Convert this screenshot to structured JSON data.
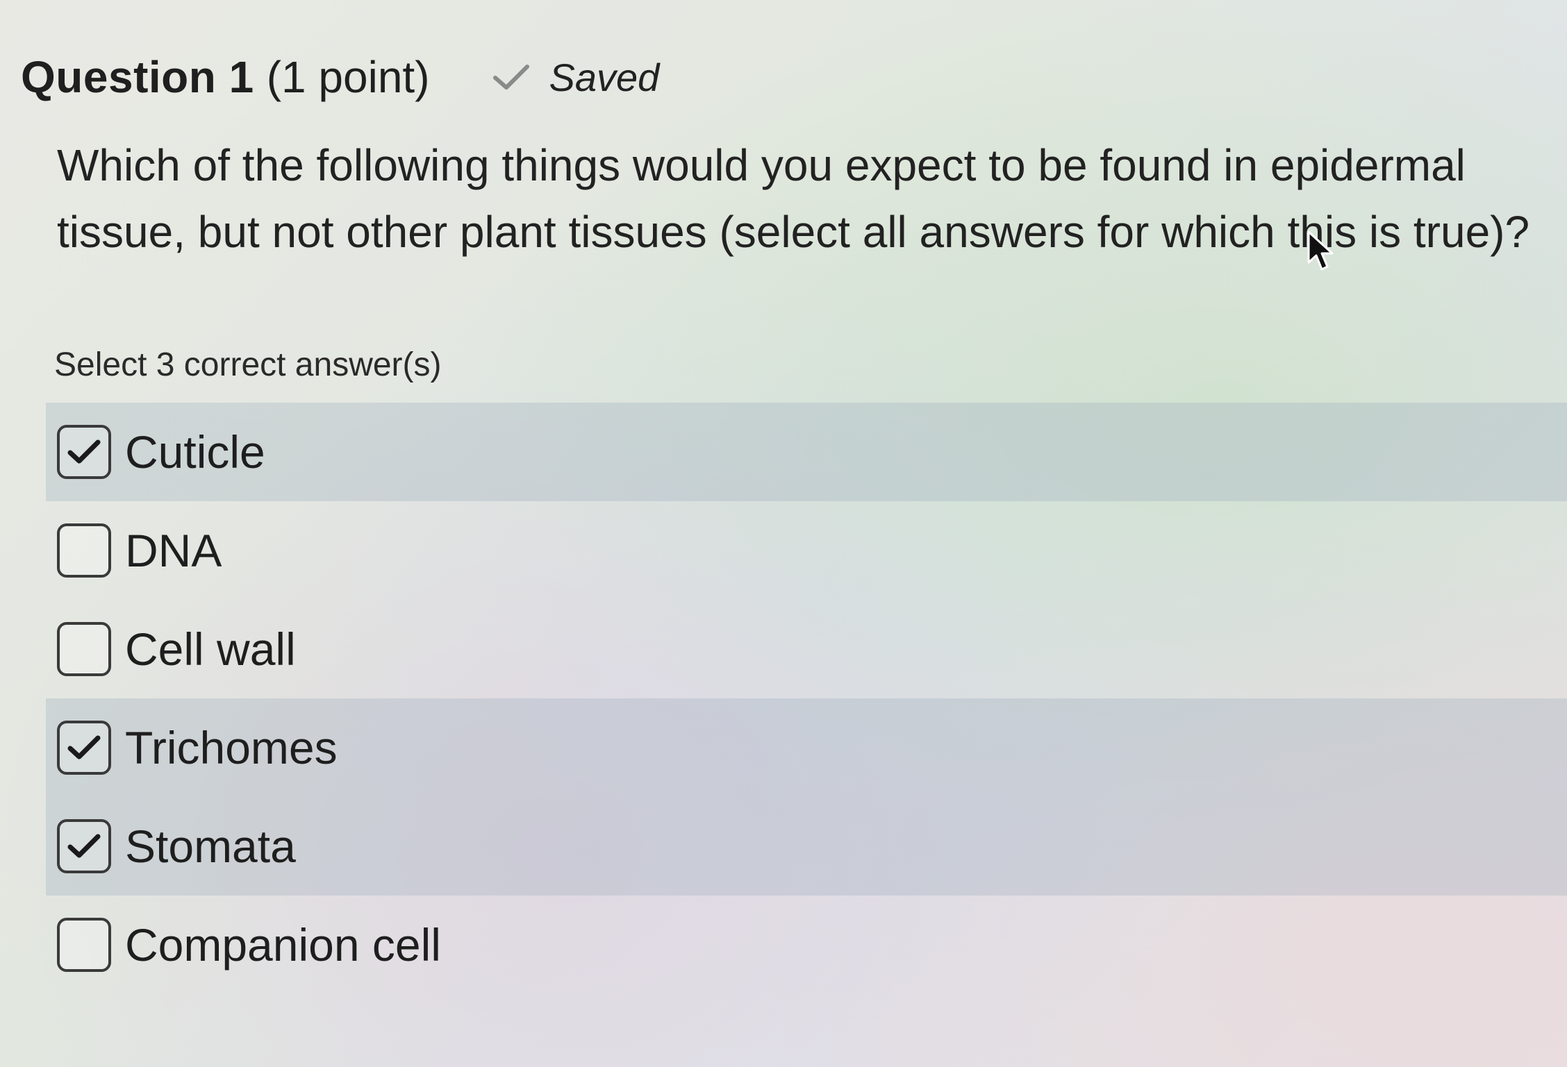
{
  "question": {
    "title": "Question 1",
    "points": "(1 point)",
    "status": "Saved",
    "prompt": "Which of the following things would you expect to be found in epidermal tissue, but not other plant tissues (select all answers for which this is true)?",
    "instruction": "Select 3 correct answer(s)"
  },
  "options": [
    {
      "label": "Cuticle",
      "checked": true
    },
    {
      "label": "DNA",
      "checked": false
    },
    {
      "label": "Cell wall",
      "checked": false
    },
    {
      "label": "Trichomes",
      "checked": true
    },
    {
      "label": "Stomata",
      "checked": true
    },
    {
      "label": "Companion cell",
      "checked": false
    }
  ],
  "icons": {
    "saved": "check-icon",
    "checkbox_checked": "checkmark-icon",
    "pointer": "mouse-pointer-icon"
  },
  "colors": {
    "selected_row": "#a0afbe",
    "text": "#1f1f1f",
    "saved_check": "#8a8a8a"
  }
}
